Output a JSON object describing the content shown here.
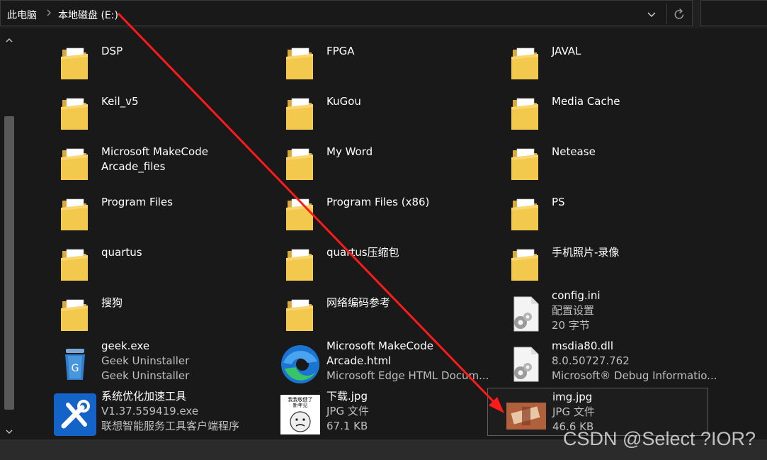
{
  "breadcrumb": {
    "root": "此电脑",
    "current": "本地磁盘 (E:)"
  },
  "items": [
    {
      "name": "DSP",
      "col": 0,
      "row": 0,
      "icon": "folder-icon"
    },
    {
      "name": "FPGA",
      "col": 1,
      "row": 0,
      "icon": "folder-icon"
    },
    {
      "name": "JAVAL",
      "col": 2,
      "row": 0,
      "icon": "folder-icon"
    },
    {
      "name": "Keil_v5",
      "col": 0,
      "row": 1,
      "icon": "folder-icon"
    },
    {
      "name": "KuGou",
      "col": 1,
      "row": 1,
      "icon": "folder-icon"
    },
    {
      "name": "Media Cache",
      "col": 2,
      "row": 1,
      "icon": "folder-icon"
    },
    {
      "name": "Microsoft MakeCode",
      "name2": "Arcade_files",
      "col": 0,
      "row": 2,
      "icon": "folder-icon"
    },
    {
      "name": "My Word",
      "col": 1,
      "row": 2,
      "icon": "folder-icon"
    },
    {
      "name": "Netease",
      "col": 2,
      "row": 2,
      "icon": "folder-icon"
    },
    {
      "name": "Program Files",
      "col": 0,
      "row": 3,
      "icon": "folder-icon"
    },
    {
      "name": "Program Files (x86)",
      "col": 1,
      "row": 3,
      "icon": "folder-icon"
    },
    {
      "name": "PS",
      "col": 2,
      "row": 3,
      "icon": "folder-icon"
    },
    {
      "name": "quartus",
      "col": 0,
      "row": 4,
      "icon": "folder-icon"
    },
    {
      "name": "quartus压缩包",
      "col": 1,
      "row": 4,
      "icon": "folder-icon"
    },
    {
      "name": "手机照片-录像",
      "col": 2,
      "row": 4,
      "icon": "folder-icon"
    },
    {
      "name": "搜狗",
      "col": 0,
      "row": 5,
      "icon": "folder-icon"
    },
    {
      "name": "网络编码参考",
      "col": 1,
      "row": 5,
      "icon": "folder-icon"
    },
    {
      "name": "config.ini",
      "type": "配置设置",
      "size": "20 字节",
      "col": 2,
      "row": 5,
      "icon": "settings-file-icon"
    },
    {
      "name": "geek.exe",
      "type": "Geek Uninstaller",
      "size": "Geek Uninstaller",
      "col": 0,
      "row": 6,
      "icon": "geek-uninstaller-icon"
    },
    {
      "name": "Microsoft MakeCode",
      "name2": "Arcade.html",
      "type": "Microsoft Edge HTML Docum...",
      "col": 1,
      "row": 6,
      "icon": "edge-icon"
    },
    {
      "name": "msdia80.dll",
      "type": "8.0.50727.762",
      "size": "Microsoft® Debug Informatio...",
      "col": 2,
      "row": 6,
      "icon": "dll-file-icon"
    },
    {
      "name": "系统优化加速工具",
      "type": "V1.37.559419.exe",
      "size": "联想智能服务工具客户端程序",
      "col": 0,
      "row": 7,
      "icon": "tools-icon"
    },
    {
      "name": "下载.jpg",
      "type": "JPG 文件",
      "size": "67.1 KB",
      "col": 1,
      "row": 7,
      "icon": "image-thumbnail-icon"
    },
    {
      "name": "img.jpg",
      "type": "JPG 文件",
      "size": "46.6 KB",
      "col": 2,
      "row": 7,
      "icon": "image-thumbnail-icon",
      "selected": true
    }
  ],
  "thumb_text": "我我敬健了\n新年见",
  "colors": {
    "background": "#191919",
    "folder": "#f2c94c",
    "arrow": "#ff1a1a",
    "edge_blue": "#1b74d1",
    "edge_green": "#3ac46a"
  },
  "watermark": "CSDN @Select ?IOR?"
}
